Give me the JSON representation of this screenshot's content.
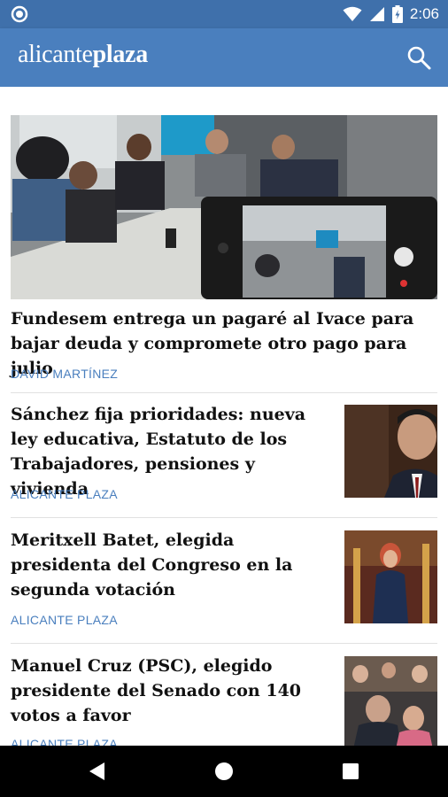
{
  "status_bar": {
    "time": "2:06"
  },
  "app_bar": {
    "logo_light": "alicante",
    "logo_bold": "plaza"
  },
  "hero": {
    "title": "Fundesem entrega un pagaré al Ivace para bajar deuda y compromete otro pago para julio",
    "author": "DAVID MARTÍNEZ"
  },
  "articles": [
    {
      "title": "Sánchez fija prioridades: nueva ley educativa, Estatuto de los Trabajadores, pensiones y vivienda",
      "author": "ALICANTE PLAZA"
    },
    {
      "title": "Meritxell Batet, elegida presidenta del Congreso en la segunda votación",
      "author": "ALICANTE PLAZA"
    },
    {
      "title": "Manuel Cruz (PSC), elegido presidente del Senado con 140 votos a favor",
      "author": "ALICANTE PLAZA"
    }
  ],
  "colors": {
    "status_bar": "#3f70ab",
    "app_bar": "#4a7fbe",
    "author_text": "#4a7fbe"
  },
  "icons": {
    "status_left": "circle-icon",
    "wifi": "wifi-icon",
    "signal": "signal-icon",
    "battery": "battery-icon",
    "search": "search-icon",
    "back": "back-icon",
    "home": "home-icon",
    "recents": "recents-icon"
  }
}
